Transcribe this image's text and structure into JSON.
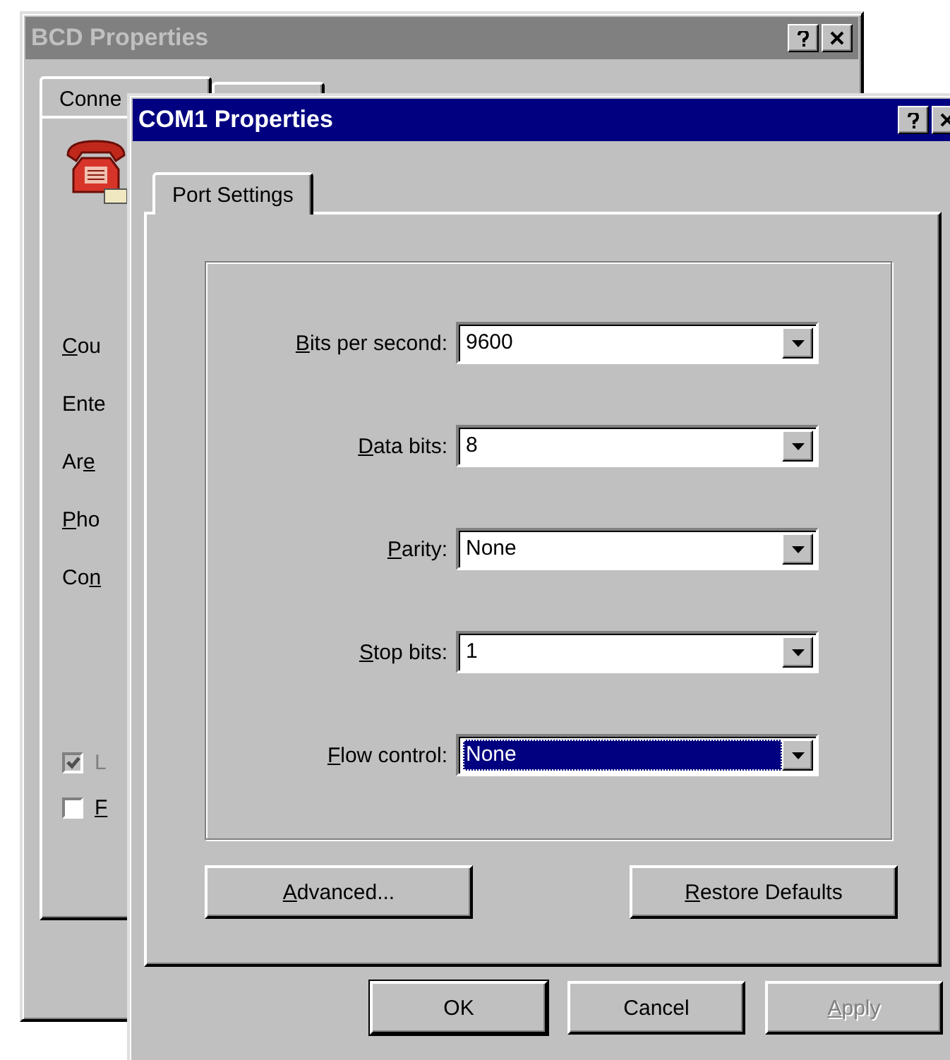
{
  "windows": [
    {
      "title": "BCD Properties",
      "active": false,
      "tabs": [
        {
          "label": "Conne",
          "selected": true
        }
      ],
      "labels": [
        {
          "key": "C",
          "after": "ou"
        },
        {
          "after": "Ente"
        },
        {
          "before": "Ar",
          "key": "e"
        },
        {
          "key": "P",
          "after": "ho"
        },
        {
          "before": "Co",
          "key": "n"
        }
      ],
      "checkboxes": [
        {
          "label": "L",
          "checked": true,
          "disabled": true
        },
        {
          "key": "F",
          "checked": false,
          "disabled": false
        }
      ]
    },
    {
      "title": "COM1 Properties",
      "active": true,
      "tabs": [
        {
          "label": "Port Settings",
          "selected": true
        }
      ],
      "fields": [
        {
          "label": {
            "key": "B",
            "after": "its per second:"
          },
          "value": "9600",
          "focused": false
        },
        {
          "label": {
            "key": "D",
            "after": "ata bits:"
          },
          "value": "8",
          "focused": false
        },
        {
          "label": {
            "key": "P",
            "after": "arity:"
          },
          "value": "None",
          "focused": false
        },
        {
          "label": {
            "key": "S",
            "after": "top bits:"
          },
          "value": "1",
          "focused": false
        },
        {
          "label": {
            "key": "F",
            "after": "low control:"
          },
          "value": "None",
          "focused": true
        }
      ],
      "panel_buttons": [
        {
          "label": {
            "key": "A",
            "after": "dvanced..."
          },
          "disabled": false
        },
        {
          "label": {
            "key": "R",
            "after": "estore Defaults"
          },
          "disabled": false
        }
      ],
      "buttons": [
        {
          "label": {
            "after": "OK"
          },
          "disabled": false,
          "default": true
        },
        {
          "label": {
            "after": "Cancel"
          },
          "disabled": false,
          "default": false
        },
        {
          "label": {
            "key": "A",
            "after": "pply"
          },
          "disabled": true,
          "default": false
        }
      ]
    }
  ]
}
